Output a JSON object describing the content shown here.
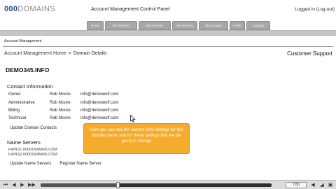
{
  "header": {
    "logo_part1": "000",
    "logo_part2": "DOMAINS",
    "panel_title": "Account Management Control Panel",
    "logged_text": "Logged in (Log-out)"
  },
  "tabs": [
    "Home",
    "My Domains",
    "My Services",
    "My Invoices",
    "My Account",
    "Order",
    "Support"
  ],
  "section_label": "Account Management",
  "breadcrumb": {
    "home": "Account Management Home",
    "arrow": ">",
    "current": "Domain Details"
  },
  "support_link": "Customer Support",
  "domain": "DEMO345.INFO",
  "contact": {
    "title": "Contact Information",
    "rows": [
      {
        "role": "Owner",
        "name": "Rob Moore",
        "email": "info@demowolf.com"
      },
      {
        "role": "Administrative",
        "name": "Rob Moore",
        "email": "info@demowolf.com"
      },
      {
        "role": "Billing",
        "name": "Rob Moore",
        "email": "info@demowolf.com"
      },
      {
        "role": "Technical",
        "name": "Rob Moore",
        "email": "info@demowolf.com"
      }
    ],
    "update_label": "Update Domain Contacts"
  },
  "name_servers": {
    "title": "Name Servers",
    "list": [
      "FWNS1.000DOMAINS.COM",
      "FWNS2.000DOMAINS.COM"
    ],
    "update_label": "Update Name Servers",
    "register_label": "Register Name Server"
  },
  "callout": {
    "text": "Here you can see the current DNS settings for this domain name, and it's these settings that we are going to change"
  },
  "player": {
    "counter": "7/30",
    "progress": 0.333
  },
  "colors": {
    "logo_blue": "#1d4f86",
    "callout": "#f5ab2b",
    "tab_gray": "#a7a7a7"
  }
}
